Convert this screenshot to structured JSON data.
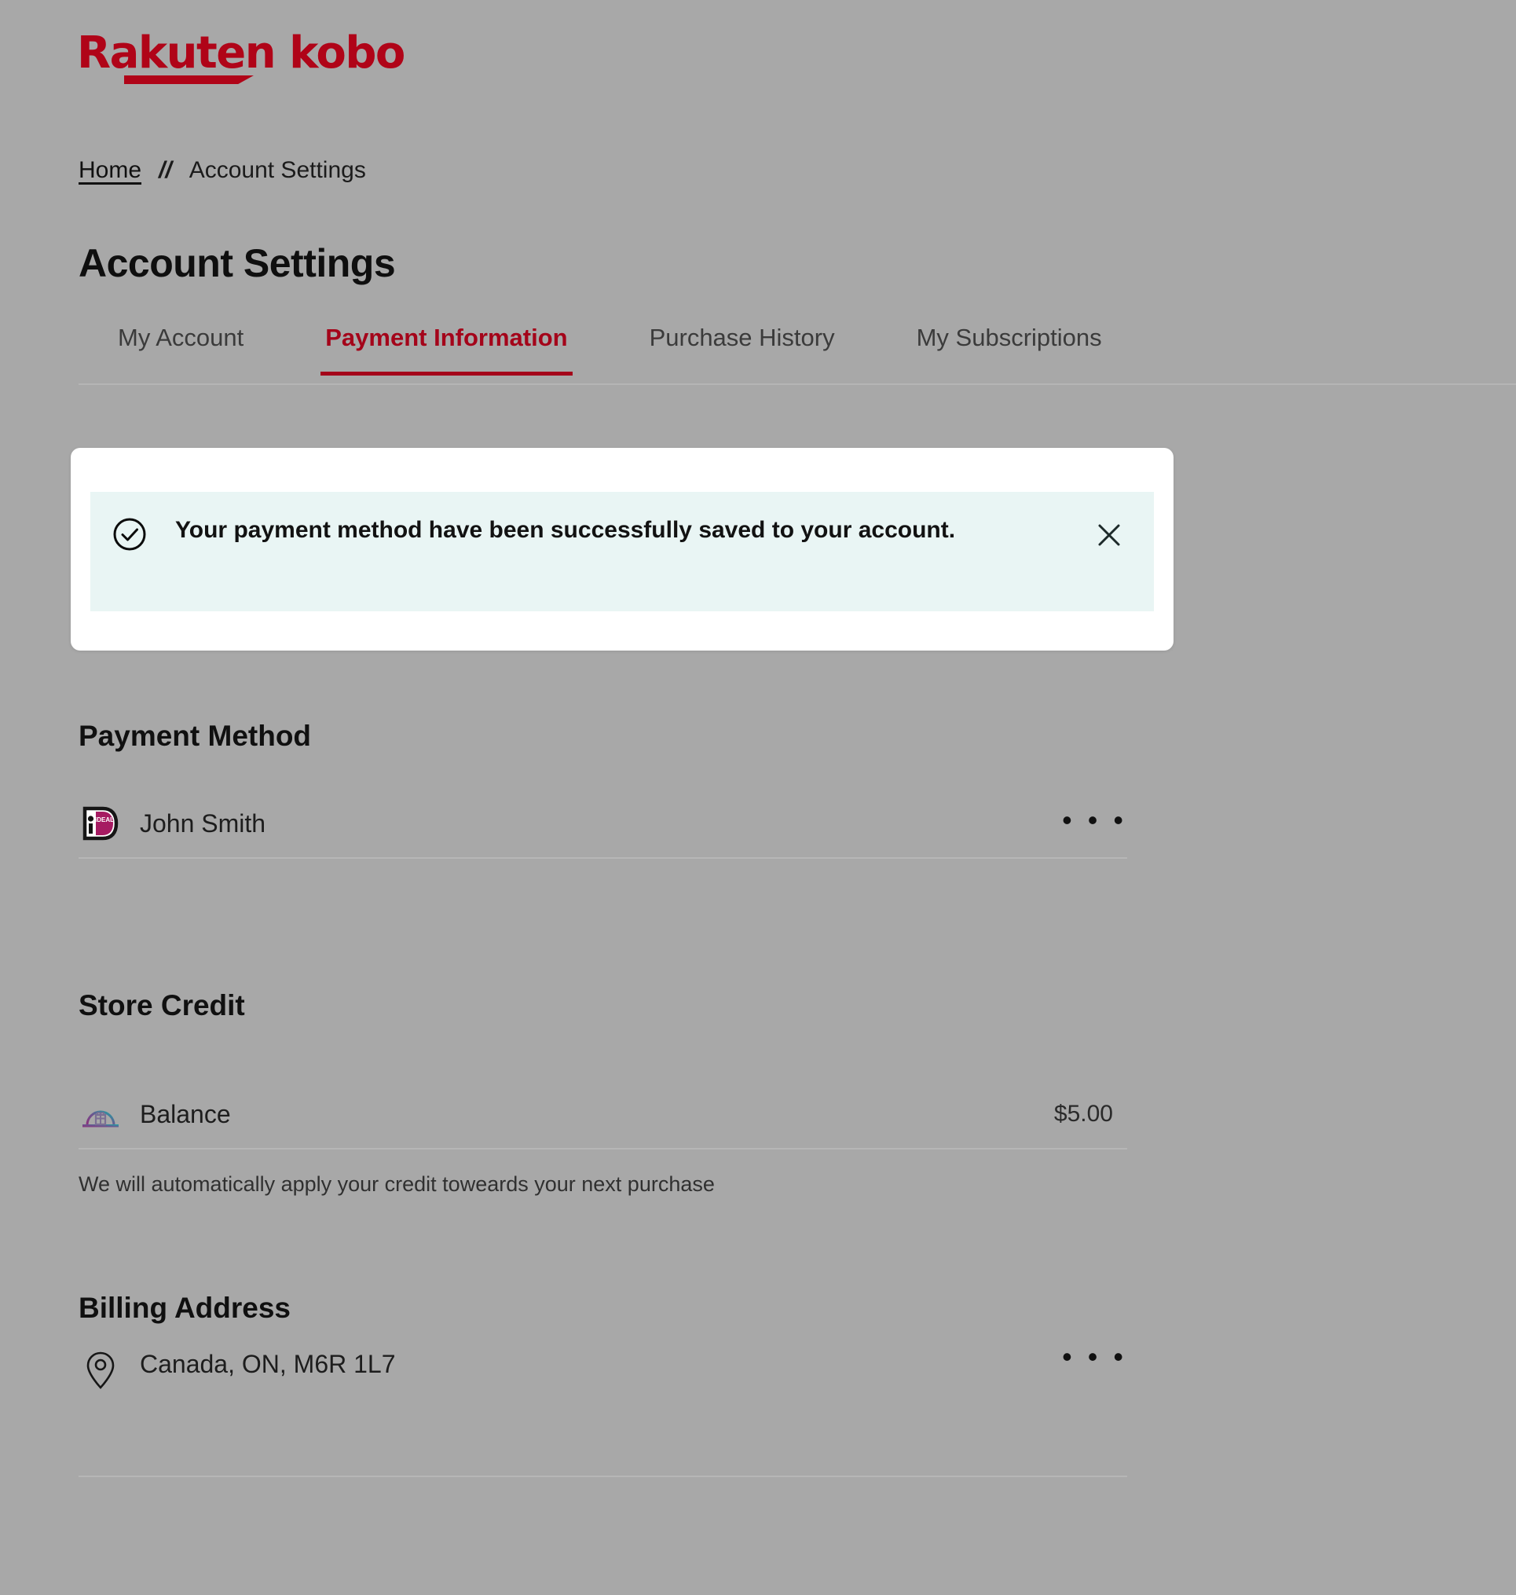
{
  "brand": {
    "logo_text": "Rakuten kobo",
    "logo_color": "#b00418",
    "accent_color": "#a4041a"
  },
  "breadcrumb": {
    "home_label": "Home",
    "separator": "//",
    "current_label": "Account Settings"
  },
  "page": {
    "title": "Account Settings"
  },
  "tabs": [
    {
      "label": "My Account",
      "active": false
    },
    {
      "label": "Payment Information",
      "active": true
    },
    {
      "label": "Purchase History",
      "active": false
    },
    {
      "label": "My Subscriptions",
      "active": false
    }
  ],
  "notification": {
    "icon": "circle-check-icon",
    "message": "Your payment method have been successfully saved to your account.",
    "close_icon": "close-icon",
    "background_color": "#e9f5f4",
    "card_color": "#ffffff"
  },
  "sections": {
    "payment_method": {
      "title": "Payment Method",
      "row": {
        "icon": "ideal-logo-icon",
        "label": "John Smith",
        "menu": "• • •"
      }
    },
    "store_credit": {
      "title": "Store Credit",
      "row": {
        "icon": "store-credit-gift-icon",
        "label": "Balance",
        "value": "$5.00"
      },
      "helper_text": "We will automatically apply your credit toweards your next purchase"
    },
    "billing_address": {
      "title": "Billing Address",
      "row": {
        "icon": "map-pin-icon",
        "label": "Canada, ON, M6R 1L7",
        "menu": "• • •"
      }
    }
  }
}
